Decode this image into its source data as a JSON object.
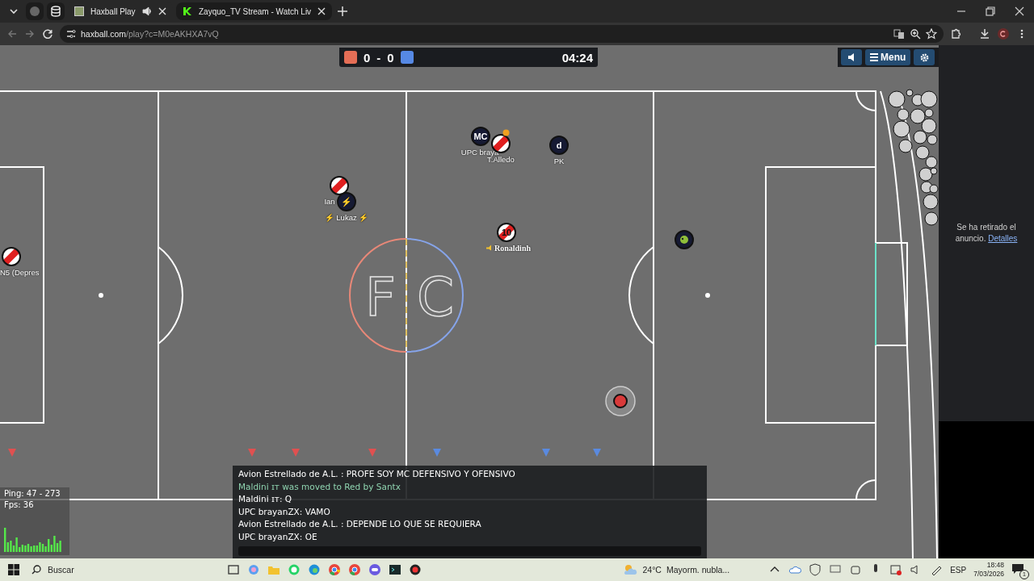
{
  "browser": {
    "tabs": [
      {
        "title": "Haxball Play",
        "selected": true,
        "audio": true
      },
      {
        "title": "Zayquo_TV Stream - Watch Liv",
        "selected": false,
        "audio": false
      }
    ],
    "address": {
      "host": "haxball.com",
      "path": "/play?c=M0eAKHXA7vQ"
    }
  },
  "game": {
    "scoreboard": {
      "teams": [
        {
          "color": "#e56e56",
          "score": "0"
        },
        {
          "color": "#5689e5",
          "score": "0"
        }
      ],
      "separator": "-",
      "time": "04:24"
    },
    "menu_button": "Menu",
    "field_logo": [
      "F",
      "C"
    ],
    "players": [
      {
        "kind": "red",
        "name": "N5 (Depres"
      },
      {
        "kind": "red",
        "name": "Ian"
      },
      {
        "kind": "blue",
        "name": "⚡ Lukaz ⚡",
        "disc_text": "⚡"
      },
      {
        "kind": "blue",
        "name": "UPC braya",
        "disc_text": "MC"
      },
      {
        "kind": "red",
        "name": "T.Alledo",
        "indicator": true
      },
      {
        "kind": "blue",
        "name": "PK",
        "disc_text": "d"
      },
      {
        "kind": "red",
        "name": "Ronaldinh",
        "disc_text": "10",
        "name_icon": true
      },
      {
        "kind": "blue",
        "disc_icon": true
      }
    ],
    "stats": {
      "ping": "Ping: 47 - 273",
      "fps": "Fps: 36"
    },
    "chat": [
      {
        "kind": "message",
        "text": "Avion Estrellado de A.L. : PROFE SOY MC DEFENSIVO Y OFENSIVO"
      },
      {
        "kind": "notice",
        "text": "Maldini ɪᴛ was moved to Red by Santx"
      },
      {
        "kind": "message",
        "text": "Maldini ɪᴛ: Q"
      },
      {
        "kind": "message",
        "text": "UPC brayanZX: VAMO"
      },
      {
        "kind": "message",
        "text": "Avion Estrellado de A.L. : DEPENDE LO QUE SE REQUIERA"
      },
      {
        "kind": "message",
        "text": "UPC brayanZX: OE"
      }
    ]
  },
  "ad": {
    "text": "Se ha retirado el anuncio.",
    "link": "Detalles"
  },
  "taskbar": {
    "search_placeholder": "Buscar",
    "temperature": "24°C",
    "weather": "Mayorm. nubla...",
    "language": "ESP",
    "time": "18:48",
    "date": "7/03/2026",
    "notifications": "1"
  }
}
